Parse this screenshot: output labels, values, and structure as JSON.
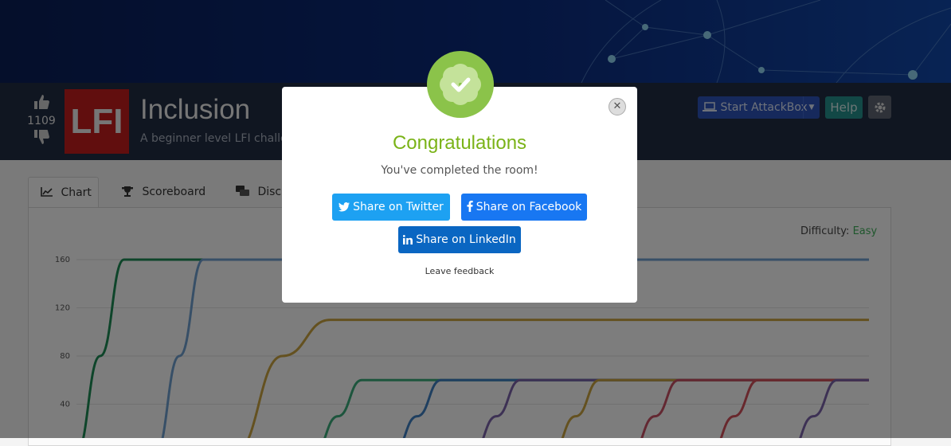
{
  "room": {
    "upvote_count": "1109",
    "icon_text": "LFI",
    "title": "Inclusion",
    "description": "A beginner level LFI challenge"
  },
  "header_actions": {
    "attackbox_label": "Start AttackBox",
    "help_label": "Help"
  },
  "tabs": [
    {
      "label": "Chart",
      "icon": "chart-icon",
      "active": true
    },
    {
      "label": "Scoreboard",
      "icon": "trophy-icon",
      "active": false
    },
    {
      "label": "Discussion",
      "icon": "chat-icon",
      "active": false
    }
  ],
  "difficulty": {
    "label": "Difficulty:",
    "value": "Easy"
  },
  "modal": {
    "title": "Congratulations",
    "message": "You've completed the room!",
    "share_twitter": "Share on Twitter",
    "share_facebook": "Share on Facebook",
    "share_linkedin": "Share on LinkedIn",
    "feedback": "Leave feedback"
  },
  "colors": {
    "twitter": "#1da1f2",
    "facebook": "#1877f2",
    "linkedin": "#0a66c2",
    "success": "#8bc34a",
    "room_icon": "#c21c1c"
  },
  "chart_data": {
    "type": "line",
    "y_ticks": [
      40,
      80,
      120,
      160
    ],
    "ylim": [
      0,
      175
    ],
    "grid": true,
    "series": [
      {
        "color": "#1c8a55",
        "x": [
          0,
          3,
          6
        ],
        "y": [
          0,
          80,
          160
        ],
        "final": 160
      },
      {
        "color": "#6f9fcf",
        "x": [
          10,
          13,
          16
        ],
        "y": [
          0,
          80,
          160
        ],
        "final": 160
      },
      {
        "color": "#c9a341",
        "x": [
          20,
          26,
          32
        ],
        "y": [
          0,
          80,
          110
        ],
        "final": 110
      },
      {
        "color": "#3aab7a",
        "x": [
          30,
          33,
          36
        ],
        "y": [
          0,
          30,
          60
        ],
        "final": 60
      },
      {
        "color": "#3e7fc0",
        "x": [
          40,
          43,
          46
        ],
        "y": [
          0,
          30,
          60
        ],
        "final": 60
      },
      {
        "color": "#7b63a8",
        "x": [
          50,
          53,
          56
        ],
        "y": [
          0,
          30,
          60
        ],
        "final": 60
      },
      {
        "color": "#c9a341",
        "x": [
          60,
          63,
          66
        ],
        "y": [
          0,
          30,
          60
        ],
        "final": 60
      },
      {
        "color": "#c75064",
        "x": [
          70,
          73,
          76
        ],
        "y": [
          0,
          30,
          60
        ],
        "final": 60
      },
      {
        "color": "#d0505a",
        "x": [
          80,
          83,
          86
        ],
        "y": [
          0,
          30,
          60
        ],
        "final": 60
      },
      {
        "color": "#7b63a8",
        "x": [
          90,
          93,
          96
        ],
        "y": [
          0,
          30,
          60
        ],
        "final": 60
      }
    ]
  }
}
